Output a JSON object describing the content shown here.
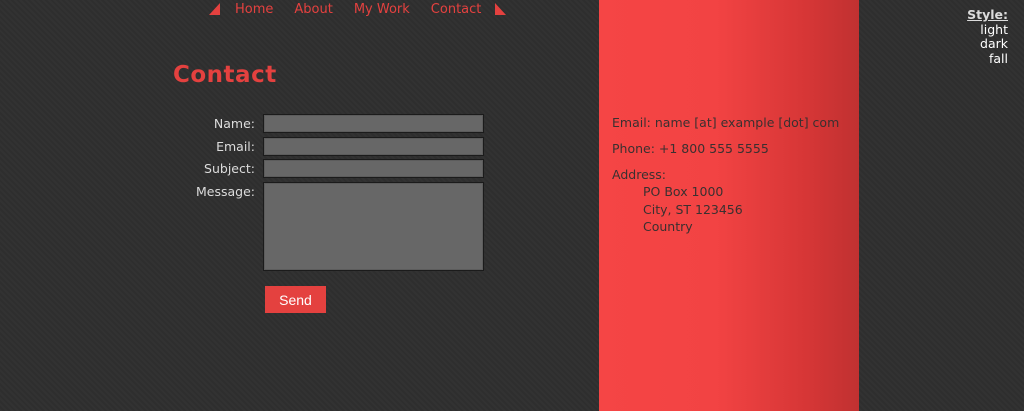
{
  "nav": {
    "items": [
      {
        "label": "Home"
      },
      {
        "label": "About"
      },
      {
        "label": "My Work"
      },
      {
        "label": "Contact"
      }
    ]
  },
  "page": {
    "title": "Contact"
  },
  "form": {
    "name_label": "Name:",
    "email_label": "Email:",
    "subject_label": "Subject:",
    "message_label": "Message:",
    "name_value": "",
    "email_value": "",
    "subject_value": "",
    "message_value": "",
    "send_label": "Send"
  },
  "contact_info": {
    "email": "Email: name [at] example [dot] com",
    "phone": "Phone: +1 800 555 5555",
    "address_label": "Address:",
    "address_lines": [
      "PO Box 1000",
      "City, ST 123456",
      "Country"
    ]
  },
  "style_switcher": {
    "title": "Style:",
    "options": [
      "light",
      "dark",
      "fall"
    ]
  },
  "colors": {
    "accent": "#e4413f",
    "background": "#2f2f2f",
    "panel": "#f24343",
    "field": "#676767"
  }
}
